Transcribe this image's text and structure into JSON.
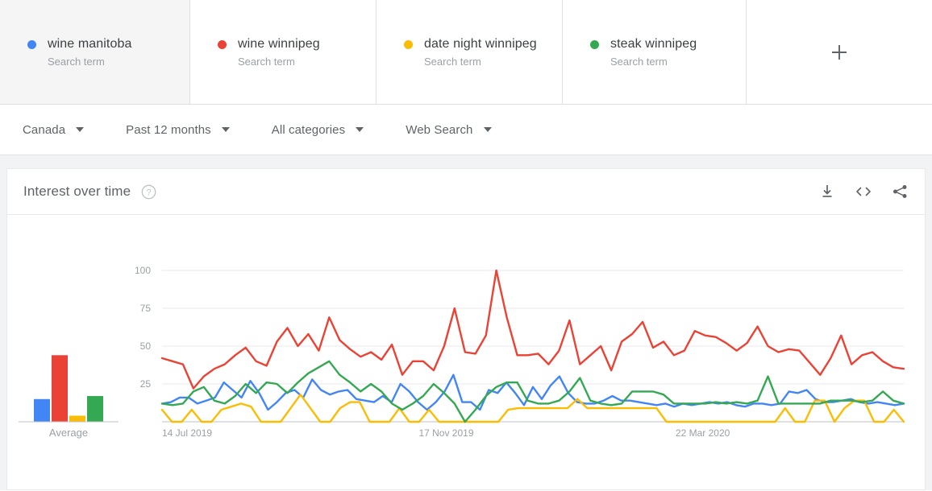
{
  "compare": {
    "terms": [
      {
        "name": "wine manitoba",
        "type": "Search term",
        "color": "#4285F4",
        "selected": true
      },
      {
        "name": "wine winnipeg",
        "type": "Search term",
        "color": "#EA4335",
        "selected": false
      },
      {
        "name": "date night winnipeg",
        "type": "Search term",
        "color": "#FBBC04",
        "selected": false
      },
      {
        "name": "steak winnipeg",
        "type": "Search term",
        "color": "#34A853",
        "selected": false
      }
    ],
    "add_label": "+"
  },
  "filters": [
    {
      "label": "Canada"
    },
    {
      "label": "Past 12 months"
    },
    {
      "label": "All categories"
    },
    {
      "label": "Web Search"
    }
  ],
  "panel": {
    "title": "Interest over time",
    "help_icon": "help-icon",
    "actions": [
      {
        "icon": "download-icon"
      },
      {
        "icon": "embed-icon"
      },
      {
        "icon": "share-icon"
      }
    ]
  },
  "chart_data": {
    "type": "line",
    "title": "Interest over time",
    "xlabel": "",
    "ylabel": "",
    "ylim": [
      0,
      100
    ],
    "yticks": [
      25,
      50,
      75,
      100
    ],
    "grid": true,
    "legend": "top-cards",
    "xtick_labels": [
      "14 Jul 2019",
      "17 Nov 2019",
      "22 Mar 2020"
    ],
    "xtick_positions": [
      0,
      18,
      36
    ],
    "n_points": 53,
    "series": [
      {
        "name": "wine manitoba",
        "color": "#4285F4",
        "values": [
          12,
          13,
          16,
          16,
          12,
          14,
          16,
          26,
          21,
          16,
          27,
          19,
          8,
          13,
          19,
          21,
          16,
          28,
          21,
          18,
          20,
          21,
          15,
          14,
          13,
          17,
          13,
          25,
          20,
          13,
          8,
          13,
          20,
          31,
          13,
          13,
          8,
          21,
          19,
          26,
          19,
          11,
          23,
          15,
          24,
          30,
          19,
          13,
          12,
          12,
          14,
          17,
          14,
          14,
          13,
          12,
          11,
          12,
          10,
          12,
          11,
          12,
          13,
          12,
          13,
          11,
          10,
          12,
          12,
          11,
          12,
          20,
          19,
          21,
          15,
          13,
          13,
          14,
          15,
          13,
          12,
          13,
          12,
          11,
          12
        ]
      },
      {
        "name": "wine winnipeg",
        "color": "#EA4335",
        "values": [
          42,
          40,
          38,
          22,
          30,
          35,
          38,
          44,
          49,
          40,
          37,
          53,
          62,
          50,
          58,
          47,
          69,
          54,
          48,
          43,
          46,
          41,
          51,
          31,
          40,
          40,
          34,
          50,
          75,
          46,
          45,
          57,
          100,
          69,
          44,
          44,
          45,
          38,
          47,
          67,
          38,
          44,
          50,
          34,
          53,
          58,
          66,
          49,
          53,
          44,
          47,
          60,
          57,
          56,
          52,
          47,
          52,
          63,
          50,
          46,
          48,
          47,
          39,
          31,
          42,
          57,
          38,
          44,
          46,
          40,
          36,
          35
        ]
      },
      {
        "name": "date night winnipeg",
        "color": "#FBBC04",
        "values": [
          8,
          0,
          0,
          8,
          0,
          0,
          8,
          10,
          12,
          10,
          0,
          0,
          0,
          9,
          18,
          9,
          0,
          0,
          9,
          13,
          13,
          0,
          0,
          0,
          9,
          0,
          0,
          8,
          0,
          0,
          0,
          0,
          0,
          0,
          0,
          8,
          9,
          9,
          9,
          9,
          9,
          9,
          15,
          9,
          9,
          9,
          9,
          9,
          9,
          9,
          9,
          0,
          0,
          0,
          0,
          0,
          0,
          0,
          0,
          0,
          0,
          0,
          0,
          9,
          0,
          0,
          14,
          14,
          0,
          9,
          14,
          14,
          0,
          0,
          8,
          0
        ]
      },
      {
        "name": "steak winnipeg",
        "color": "#34A853",
        "values": [
          12,
          11,
          12,
          20,
          23,
          14,
          12,
          17,
          25,
          19,
          26,
          25,
          19,
          26,
          32,
          36,
          40,
          31,
          26,
          20,
          25,
          20,
          12,
          8,
          12,
          17,
          25,
          19,
          12,
          0,
          8,
          17,
          23,
          26,
          26,
          14,
          12,
          12,
          14,
          20,
          29,
          14,
          12,
          11,
          12,
          20,
          20,
          20,
          18,
          12,
          12,
          12,
          12,
          13,
          12,
          13,
          12,
          14,
          30,
          12,
          12,
          12,
          12,
          12,
          14,
          14,
          14,
          13,
          14,
          20,
          14,
          12
        ]
      }
    ],
    "average_bars": {
      "label": "Average",
      "values": [
        15,
        44,
        4,
        17
      ],
      "colors": [
        "#4285F4",
        "#EA4335",
        "#FBBC04",
        "#34A853"
      ]
    }
  }
}
